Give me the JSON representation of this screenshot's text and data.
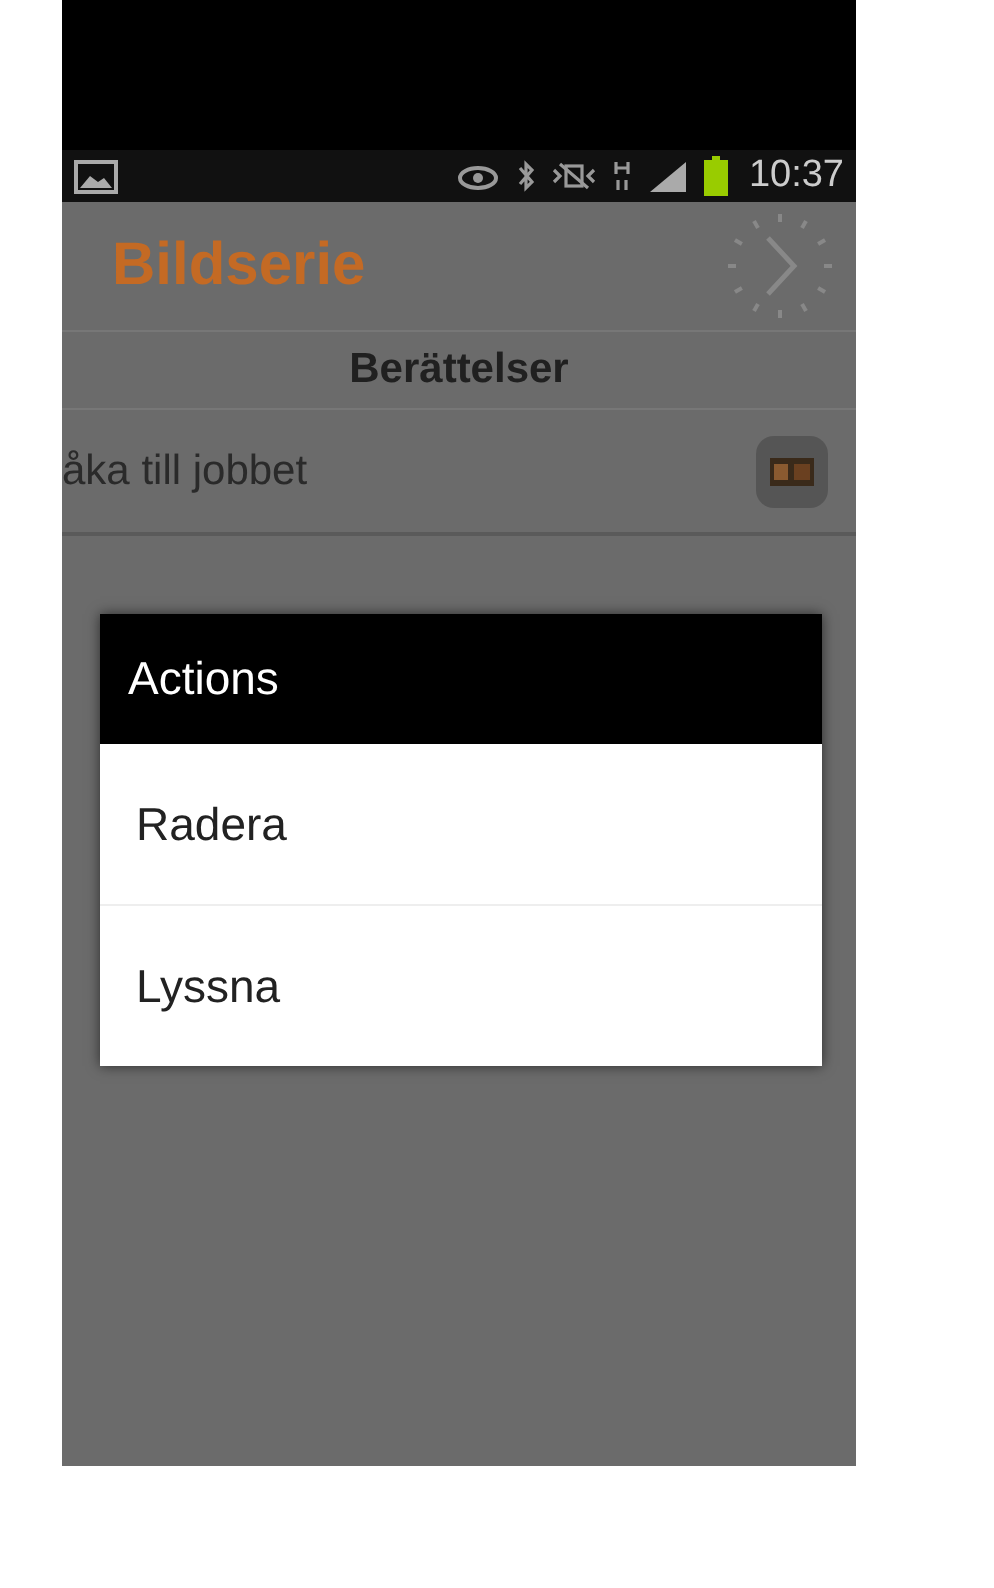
{
  "status_bar": {
    "time": "10:37"
  },
  "app_bar": {
    "title": "Bildserie"
  },
  "section_header": {
    "title": "Berättelser"
  },
  "stories": [
    {
      "title": "åka till jobbet"
    }
  ],
  "dialog": {
    "title": "Actions",
    "items": [
      {
        "label": "Radera"
      },
      {
        "label": "Lyssna"
      }
    ]
  }
}
